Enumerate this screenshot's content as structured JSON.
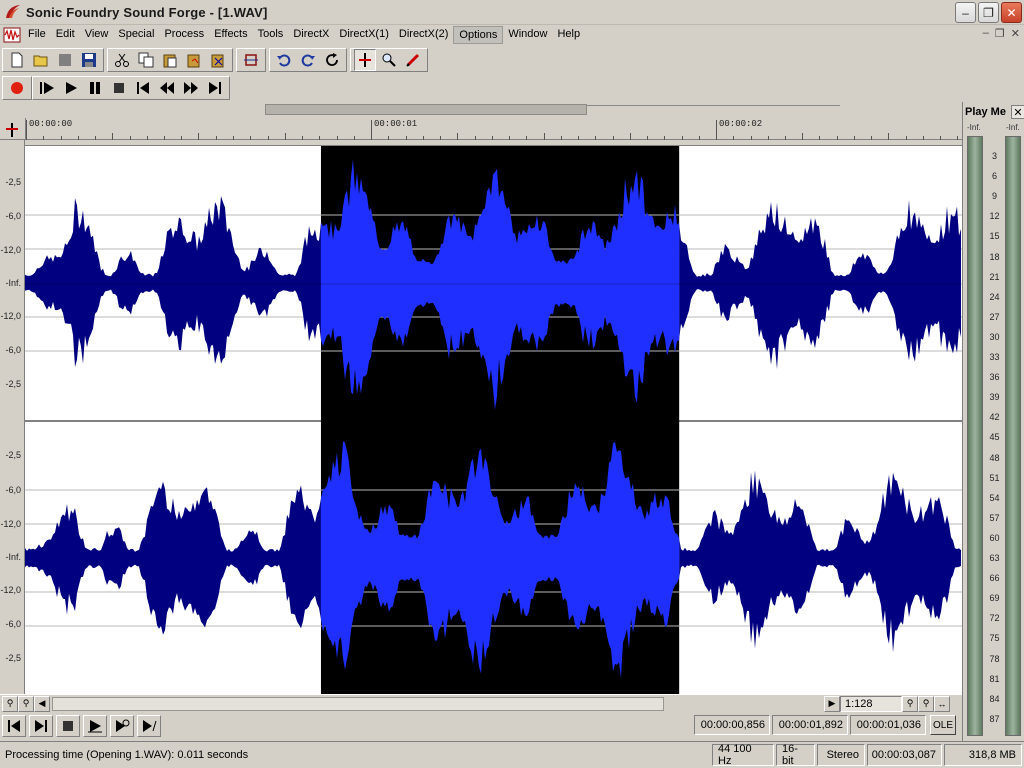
{
  "window": {
    "title": "Sonic Foundry Sound Forge - [1.WAV]"
  },
  "menu": [
    {
      "label": "File"
    },
    {
      "label": "Edit"
    },
    {
      "label": "View"
    },
    {
      "label": "Special"
    },
    {
      "label": "Process"
    },
    {
      "label": "Effects"
    },
    {
      "label": "Tools"
    },
    {
      "label": "DirectX"
    },
    {
      "label": "DirectX(1)"
    },
    {
      "label": "DirectX(2)"
    },
    {
      "label": "Options",
      "active": true
    },
    {
      "label": "Window"
    },
    {
      "label": "Help"
    }
  ],
  "toolbar_icons": [
    "new-icon",
    "open-icon",
    "close-file-icon",
    "save-icon",
    "cut-icon",
    "copy-icon",
    "paste-icon",
    "paste-mix-icon",
    "paste-crossfade-icon",
    "trim-crop-icon",
    "undo-icon",
    "redo-icon",
    "repeat-icon",
    "edit-tool-icon",
    "magnify-tool-icon",
    "pencil-tool-icon"
  ],
  "transport_icons": [
    "record-icon",
    "play-all-icon",
    "play-icon",
    "pause-icon",
    "stop-icon",
    "go-to-start-icon",
    "rewind-icon",
    "forward-icon",
    "go-to-end-icon"
  ],
  "ruler": {
    "labels": [
      "00:00:00",
      "00:00:01",
      "00:00:02"
    ]
  },
  "db_scale": {
    "channel_1": [
      "-2,5",
      "-6,0",
      "-12,0",
      "-Inf.",
      "-12,0",
      "-6,0",
      "-2,5"
    ],
    "channel_2": [
      "-2,5",
      "-6,0",
      "-12,0",
      "-Inf.",
      "-12,0",
      "-6,0",
      "-2,5"
    ]
  },
  "waveform": {
    "color_unselected": "#000080",
    "color_selected": "#1f2fff",
    "selection_background": "#000000",
    "selection_start_seconds": 0.856,
    "selection_end_seconds": 1.892,
    "visible_seconds": 2.71,
    "channels": 2
  },
  "navigation": {
    "zoom_ratio": "1:128"
  },
  "times": {
    "selection_start": "00:00:00,856",
    "selection_end": "00:00:01,892",
    "selection_length": "00:00:01,036",
    "ole_label": "OLE"
  },
  "status": {
    "message": "Processing time (Opening 1.WAV): 0.011 seconds",
    "sample_rate": "44 100 Hz",
    "bit_depth": "16-bit",
    "channels": "Stereo",
    "length": "00:00:03,087",
    "free_space": "318,8 MB"
  },
  "play_meter": {
    "title": "Play Me",
    "inf_left": "-Inf.",
    "inf_right": "-Inf.",
    "scale": [
      "3",
      "6",
      "9",
      "12",
      "15",
      "18",
      "21",
      "24",
      "27",
      "30",
      "33",
      "36",
      "39",
      "42",
      "45",
      "48",
      "51",
      "54",
      "57",
      "60",
      "63",
      "66",
      "69",
      "72",
      "75",
      "78",
      "81",
      "84",
      "87"
    ]
  }
}
